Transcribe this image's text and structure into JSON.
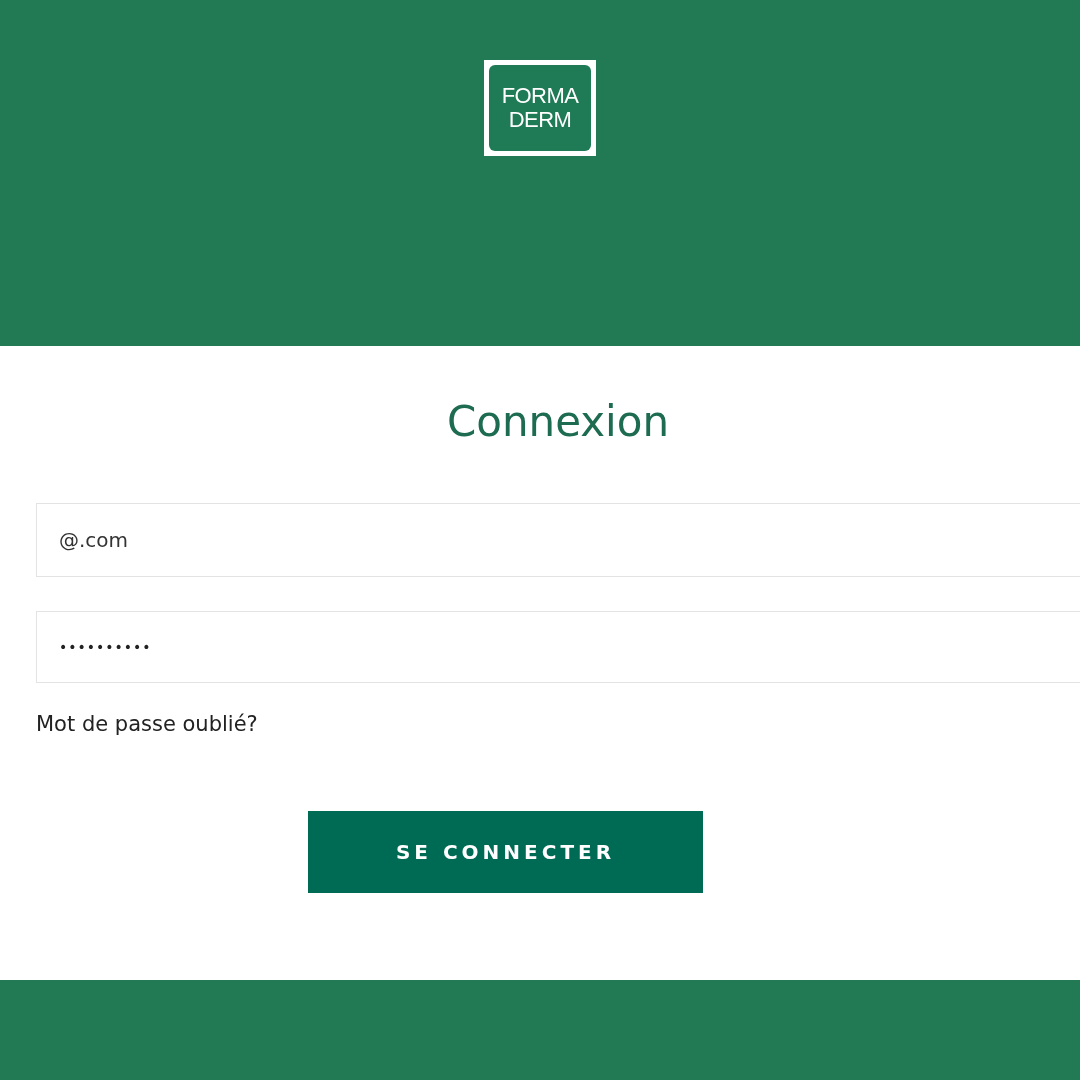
{
  "logo": {
    "lines": [
      "FORMA",
      "DERM"
    ]
  },
  "title": "Connexion",
  "email_field": {
    "value": "@.com"
  },
  "password_field": {
    "value": "••••••••••"
  },
  "forgot_link": "Mot de passe oublié?",
  "submit_button": "SE CONNECTER"
}
